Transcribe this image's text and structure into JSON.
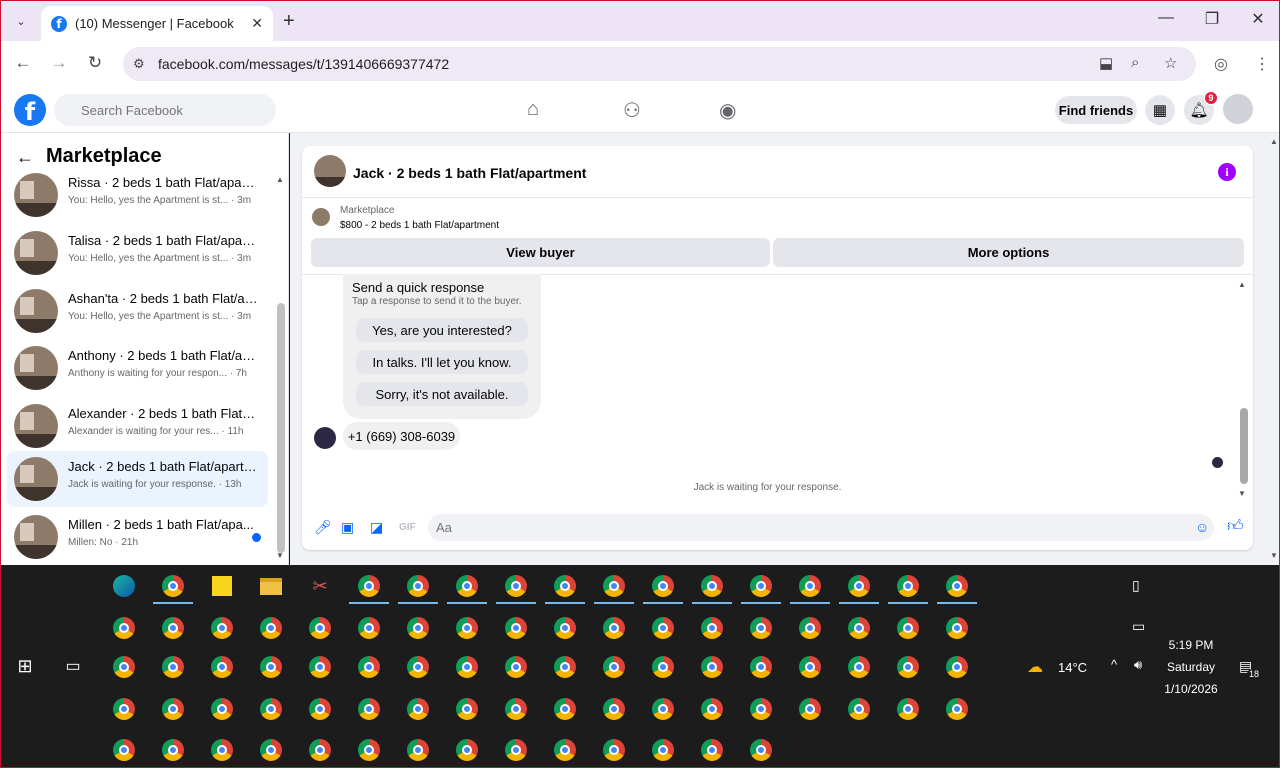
{
  "browser": {
    "tab_title": "(10) Messenger | Facebook",
    "favicon_letter": "f",
    "new_tab": "+",
    "url": "facebook.com/messages/t/1391406669377472"
  },
  "fb": {
    "logo_letter": "f",
    "search_placeholder": "Search Facebook",
    "find_friends": "Find friends",
    "notifications_count": "9"
  },
  "sidebar": {
    "title": "Marketplace",
    "conversations": [
      {
        "name": "Rissa · 2 beds 1 bath Flat/apart...",
        "snippet": "You: Hello, yes the Apartment is st...",
        "time": "· 3m"
      },
      {
        "name": "Talisa · 2 beds 1 bath Flat/apart...",
        "snippet": "You: Hello, yes the Apartment is st...",
        "time": "· 3m"
      },
      {
        "name": "Ashan'ta · 2 beds 1 bath Flat/ap...",
        "snippet": "You: Hello, yes the Apartment is st...",
        "time": "· 3m"
      },
      {
        "name": "Anthony · 2 beds 1 bath Flat/ap...",
        "snippet": "Anthony is waiting for your respon...",
        "time": "· 7h"
      },
      {
        "name": "Alexander · 2 beds 1 bath Flat/a...",
        "snippet": "Alexander is waiting for your res...",
        "time": "· 11h"
      },
      {
        "name": "Jack · 2 beds 1 bath Flat/apartm...",
        "snippet": "Jack is waiting for your response.",
        "time": "· 13h"
      },
      {
        "name": "Millen · 2 beds 1 bath Flat/apa...",
        "snippet": "Millen: No",
        "time": "· 21h"
      }
    ]
  },
  "chat": {
    "title": "Jack · 2 beds 1 bath Flat/apartment",
    "marketplace_label": "Marketplace",
    "listing": "$800 - 2 beds 1 bath Flat/apartment",
    "view_buyer": "View buyer",
    "more_options": "More options",
    "quick_response_title": "Send a quick response",
    "quick_response_sub": "Tap a response to send it to the buyer.",
    "quick_responses": [
      "Yes, are you interested?",
      "In talks. I'll let you know.",
      "Sorry, it's not available."
    ],
    "phone_message": "+1 (669) 308-6039",
    "waiting_text": "Jack is waiting for your response.",
    "composer_placeholder": "Aa",
    "gif_label": "GIF"
  },
  "taskbar": {
    "weather": "14°C",
    "time": "5:19 PM",
    "day": "Saturday",
    "date": "1/10/2026",
    "notification_count": "18"
  }
}
